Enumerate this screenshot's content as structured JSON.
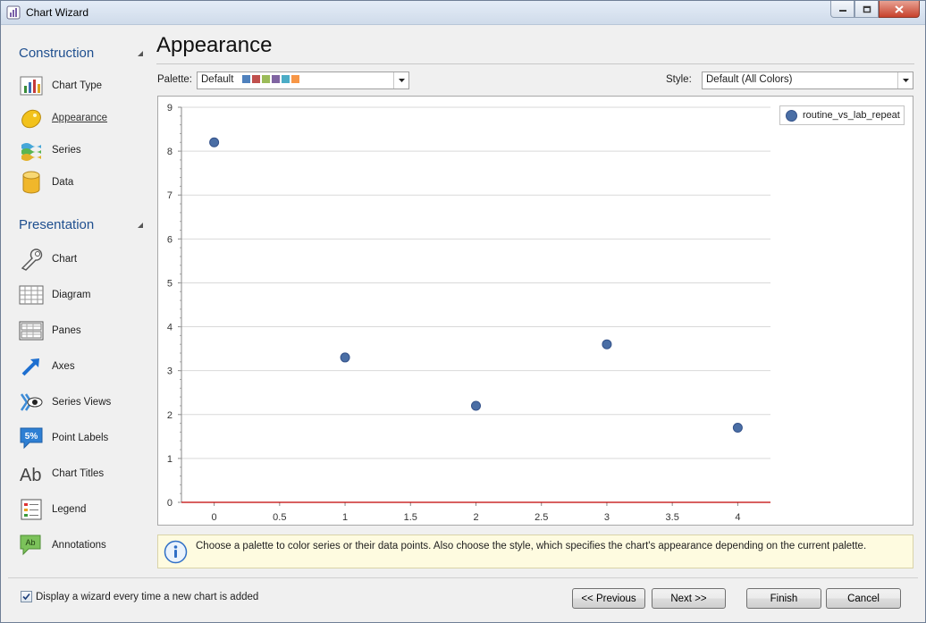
{
  "window": {
    "title": "Chart Wizard"
  },
  "sidebar": {
    "construction": {
      "header": "Construction",
      "items": [
        {
          "label": "Chart Type",
          "icon": "chart-type-icon"
        },
        {
          "label": "Appearance",
          "icon": "appearance-icon",
          "active": true
        },
        {
          "label": "Series",
          "icon": "series-icon"
        },
        {
          "label": "Data",
          "icon": "data-icon"
        }
      ]
    },
    "presentation": {
      "header": "Presentation",
      "items": [
        {
          "label": "Chart",
          "icon": "wrench-icon"
        },
        {
          "label": "Diagram",
          "icon": "diagram-icon"
        },
        {
          "label": "Panes",
          "icon": "panes-icon"
        },
        {
          "label": "Axes",
          "icon": "axes-icon"
        },
        {
          "label": "Series Views",
          "icon": "series-views-icon"
        },
        {
          "label": "Point Labels",
          "icon": "point-labels-icon"
        },
        {
          "label": "Chart Titles",
          "icon": "chart-titles-icon"
        },
        {
          "label": "Legend",
          "icon": "legend-icon"
        },
        {
          "label": "Annotations",
          "icon": "annotations-icon"
        }
      ]
    }
  },
  "main": {
    "title": "Appearance",
    "palette": {
      "label": "Palette:",
      "value": "Default",
      "swatches": [
        "#4f81bd",
        "#c0504d",
        "#9bbb59",
        "#8064a2",
        "#4bacc6",
        "#f79646"
      ]
    },
    "style": {
      "label": "Style:",
      "value": "Default (All Colors)"
    },
    "point_labels": {
      "icon_text": "5%"
    },
    "chart_titles": {
      "icon_text": "Ab"
    },
    "annotations": {
      "icon_text": "Ab"
    }
  },
  "chart_data": {
    "type": "scatter",
    "series": [
      {
        "name": "routine_vs_lab_repeat",
        "x": [
          0,
          1,
          2,
          3,
          4
        ],
        "y": [
          8.2,
          3.3,
          2.2,
          3.6,
          1.7
        ]
      }
    ],
    "x_ticks": [
      "0",
      "0.5",
      "1",
      "1.5",
      "2",
      "2.5",
      "3",
      "3.5",
      "4"
    ],
    "y_ticks": [
      "0",
      "1",
      "2",
      "3",
      "4",
      "5",
      "6",
      "7",
      "8",
      "9"
    ],
    "xlim": [
      -0.25,
      4.25
    ],
    "ylim": [
      0,
      9
    ],
    "grid": true,
    "legend_position": "top-right",
    "marker_color": "#4a6ea5"
  },
  "info": {
    "text": "Choose a palette to color series or their data points. Also choose the style, which specifies the chart's appearance depending on the current palette."
  },
  "footer": {
    "checkbox_label": "Display a wizard every time a new chart is added",
    "checkbox_checked": true,
    "buttons": {
      "previous": "<< Previous",
      "next": "Next >>",
      "finish": "Finish",
      "cancel": "Cancel"
    }
  }
}
